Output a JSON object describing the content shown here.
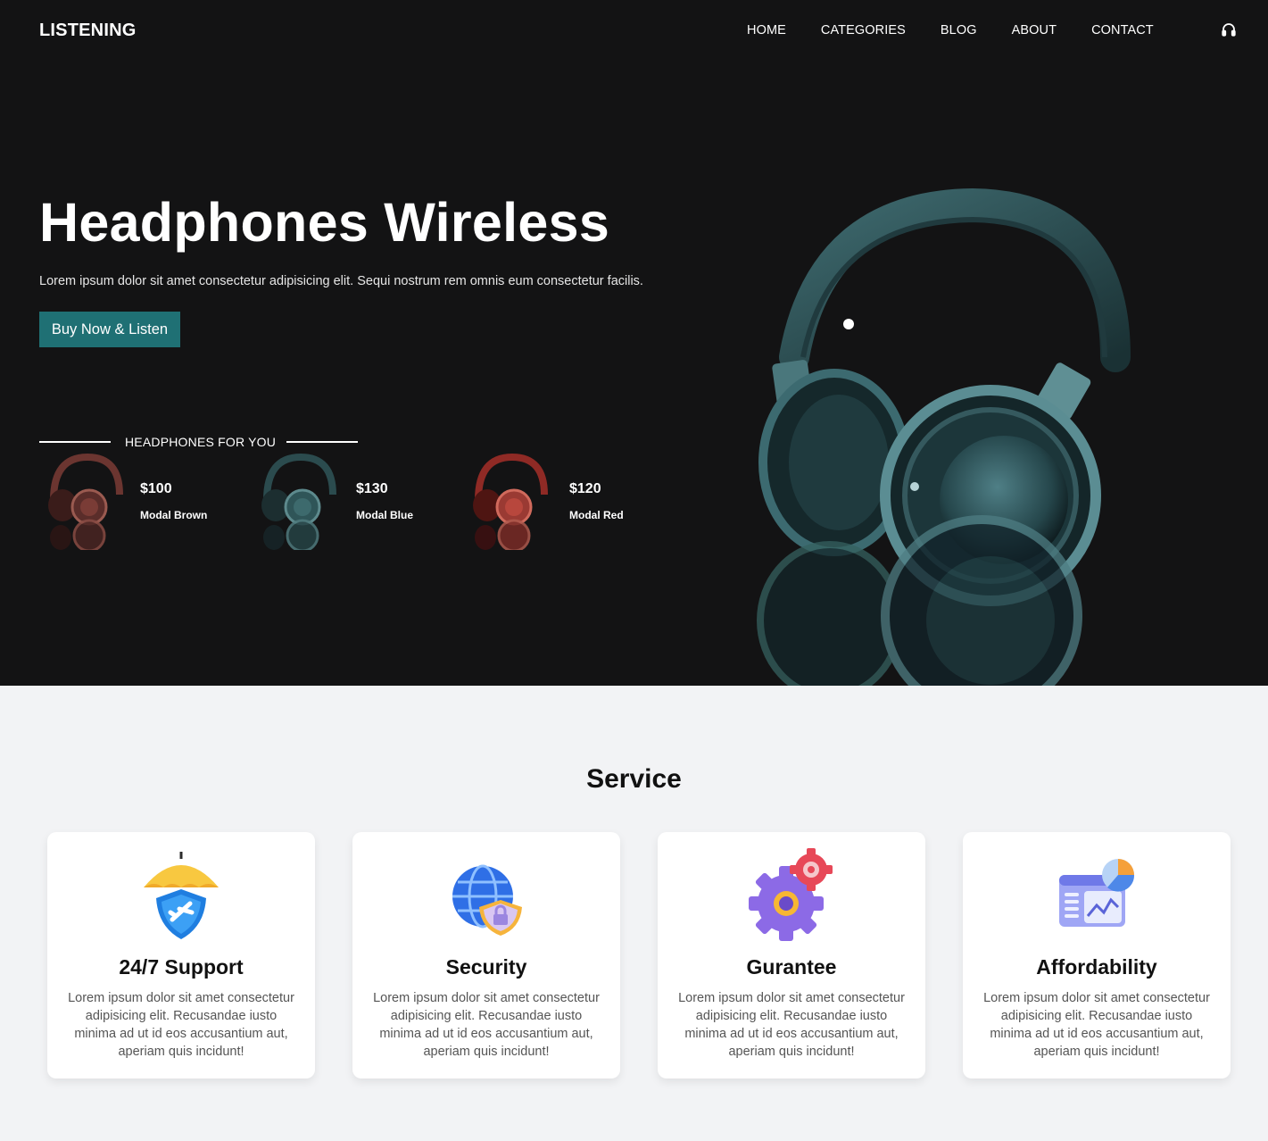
{
  "nav": {
    "logo": "LISTENING",
    "items": [
      "HOME",
      "CATEGORIES",
      "BLOG",
      "ABOUT",
      "CONTACT"
    ],
    "icon": "headphones-icon"
  },
  "hero": {
    "title": "Headphones Wireless",
    "subtitle": "Lorem ipsum dolor sit amet consectetur adipisicing elit. Sequi nostrum rem omnis eum consectetur facilis.",
    "cta_label": "Buy Now & Listen",
    "accent": "#1f7074",
    "background": "#131314"
  },
  "headphones_for_you": {
    "label": "HEADPHONES FOR YOU",
    "products": [
      {
        "price": "$100",
        "name": "Modal Brown",
        "color": "#7a3c36"
      },
      {
        "price": "$130",
        "name": "Modal Blue",
        "color": "#2f5558"
      },
      {
        "price": "$120",
        "name": "Modal Red",
        "color": "#a0302a"
      }
    ]
  },
  "service": {
    "title": "Service",
    "cards": [
      {
        "title": "24/7 Support",
        "icon": "umbrella-shield-icon",
        "text": "Lorem ipsum dolor sit amet consectetur adipisicing elit. Recusandae iusto minima ad ut id eos accusantium aut, aperiam quis incidunt!"
      },
      {
        "title": "Security",
        "icon": "globe-lock-icon",
        "text": "Lorem ipsum dolor sit amet consectetur adipisicing elit. Recusandae iusto minima ad ut id eos accusantium aut, aperiam quis incidunt!"
      },
      {
        "title": "Gurantee",
        "icon": "gears-icon",
        "text": "Lorem ipsum dolor sit amet consectetur adipisicing elit. Recusandae iusto minima ad ut id eos accusantium aut, aperiam quis incidunt!"
      },
      {
        "title": "Affordability",
        "icon": "analytics-dashboard-icon",
        "text": "Lorem ipsum dolor sit amet consectetur adipisicing elit. Recusandae iusto minima ad ut id eos accusantium aut, aperiam quis incidunt!"
      }
    ]
  }
}
